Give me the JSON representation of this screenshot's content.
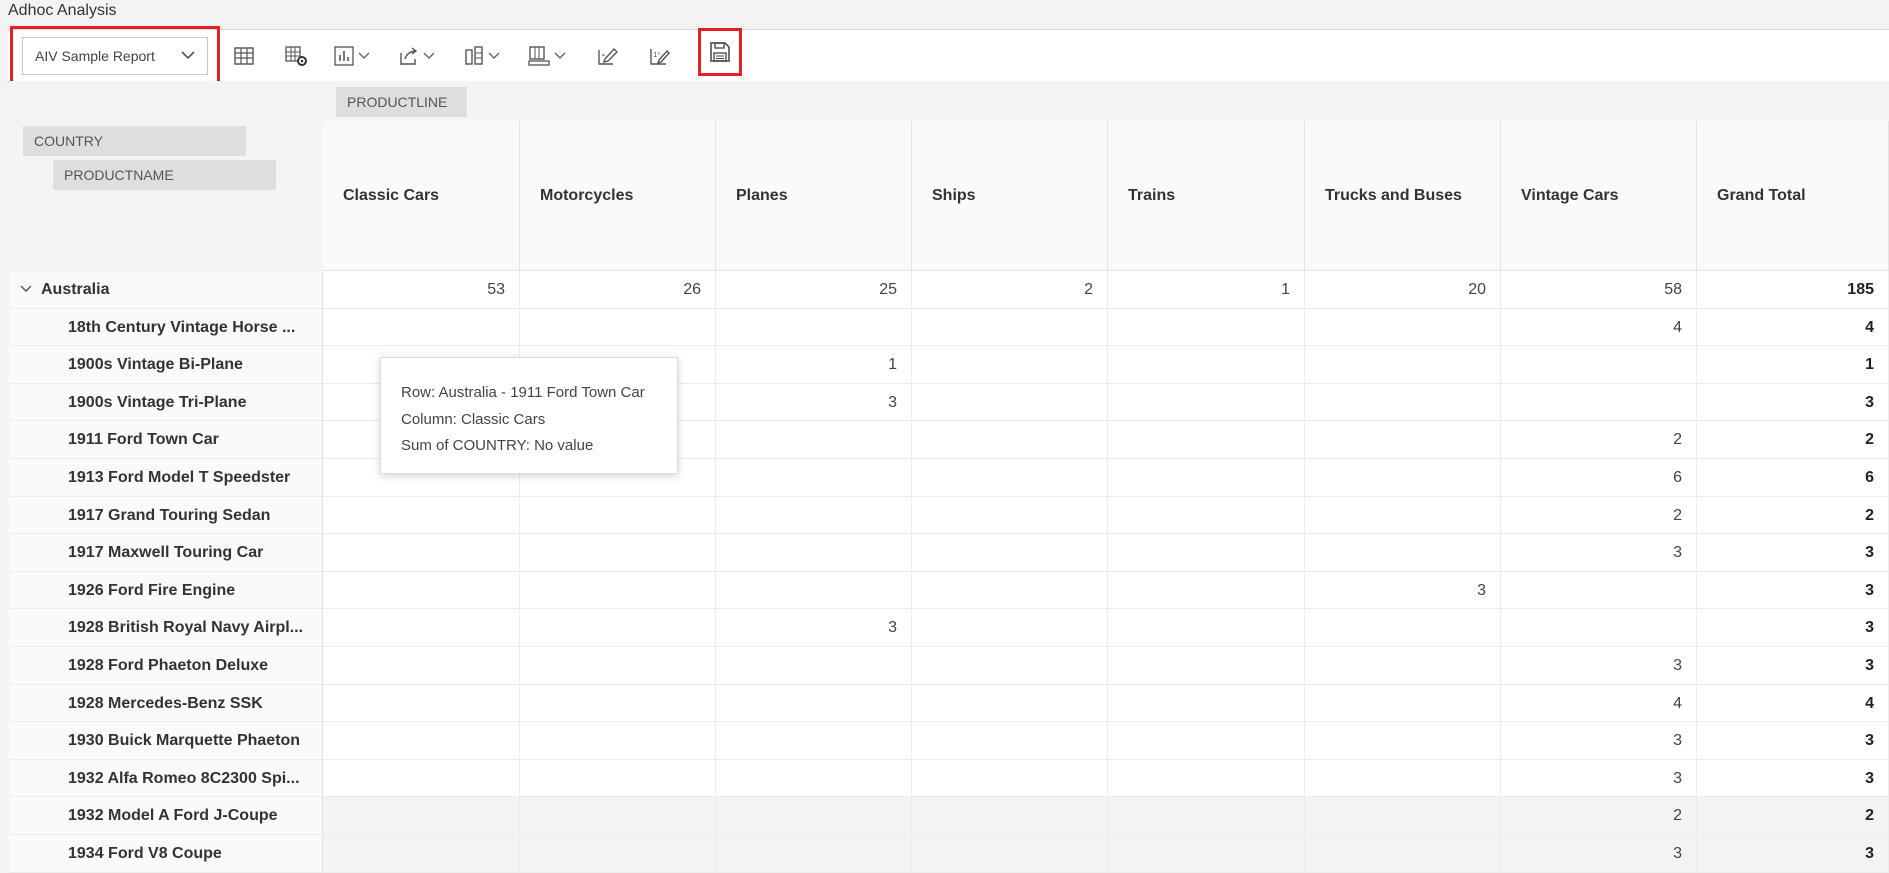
{
  "app": {
    "title": "Adhoc Analysis"
  },
  "toolbar": {
    "report_select": "AIV Sample Report",
    "buttons": [
      {
        "name": "table-view-icon",
        "dropdown": false
      },
      {
        "name": "table-settings-icon",
        "dropdown": false
      },
      {
        "name": "chart-icon",
        "dropdown": true
      },
      {
        "name": "export-icon",
        "dropdown": true
      },
      {
        "name": "row-layout-icon",
        "dropdown": true
      },
      {
        "name": "column-layout-icon",
        "dropdown": true
      },
      {
        "name": "edit-icon",
        "dropdown": false
      },
      {
        "name": "edit-formula-icon",
        "dropdown": false
      }
    ],
    "save_icon": "save-icon"
  },
  "pivot": {
    "column_field": "PRODUCTLINE",
    "row_fields": [
      "COUNTRY",
      "PRODUCTNAME"
    ],
    "columns": [
      "Classic Cars",
      "Motorcycles",
      "Planes",
      "Ships",
      "Trains",
      "Trucks and Buses",
      "Vintage Cars",
      "Grand Total"
    ],
    "rows": [
      {
        "label": "Australia",
        "group": true,
        "values": [
          "53",
          "26",
          "25",
          "2",
          "1",
          "20",
          "58",
          "185"
        ]
      },
      {
        "label": "18th Century Vintage Horse ...",
        "values": [
          "",
          "",
          "",
          "",
          "",
          "",
          "4",
          "4"
        ]
      },
      {
        "label": "1900s Vintage Bi-Plane",
        "values": [
          "",
          "",
          "1",
          "",
          "",
          "",
          "",
          "1"
        ]
      },
      {
        "label": "1900s Vintage Tri-Plane",
        "values": [
          "",
          "",
          "3",
          "",
          "",
          "",
          "",
          "3"
        ]
      },
      {
        "label": "1911 Ford Town Car",
        "values": [
          "",
          "",
          "",
          "",
          "",
          "",
          "2",
          "2"
        ]
      },
      {
        "label": "1913 Ford Model T Speedster",
        "values": [
          "",
          "",
          "",
          "",
          "",
          "",
          "6",
          "6"
        ]
      },
      {
        "label": "1917 Grand Touring Sedan",
        "values": [
          "",
          "",
          "",
          "",
          "",
          "",
          "2",
          "2"
        ]
      },
      {
        "label": "1917 Maxwell Touring Car",
        "values": [
          "",
          "",
          "",
          "",
          "",
          "",
          "3",
          "3"
        ]
      },
      {
        "label": "1926 Ford Fire Engine",
        "values": [
          "",
          "",
          "",
          "",
          "",
          "3",
          "",
          "3"
        ]
      },
      {
        "label": "1928 British Royal Navy Airpl...",
        "values": [
          "",
          "",
          "3",
          "",
          "",
          "",
          "",
          "3"
        ]
      },
      {
        "label": "1928 Ford Phaeton Deluxe",
        "values": [
          "",
          "",
          "",
          "",
          "",
          "",
          "3",
          "3"
        ]
      },
      {
        "label": "1928 Mercedes-Benz SSK",
        "values": [
          "",
          "",
          "",
          "",
          "",
          "",
          "4",
          "4"
        ]
      },
      {
        "label": "1930 Buick Marquette Phaeton",
        "values": [
          "",
          "",
          "",
          "",
          "",
          "",
          "3",
          "3"
        ]
      },
      {
        "label": "1932 Alfa Romeo 8C2300 Spi...",
        "values": [
          "",
          "",
          "",
          "",
          "",
          "",
          "3",
          "3"
        ]
      },
      {
        "label": "1932 Model A Ford J-Coupe",
        "values": [
          "",
          "",
          "",
          "",
          "",
          "",
          "2",
          "2"
        ]
      },
      {
        "label": "1934 Ford V8 Coupe",
        "values": [
          "",
          "",
          "",
          "",
          "",
          "",
          "3",
          "3"
        ]
      }
    ]
  },
  "tooltip": {
    "row": "Row: Australia - 1911 Ford Town Car",
    "column": "Column: Classic Cars",
    "value": "Sum of COUNTRY: No value"
  },
  "colors": {
    "highlight": "#e3202c",
    "chip_bg": "#dedede",
    "toolbar_bg": "#ffffff"
  }
}
